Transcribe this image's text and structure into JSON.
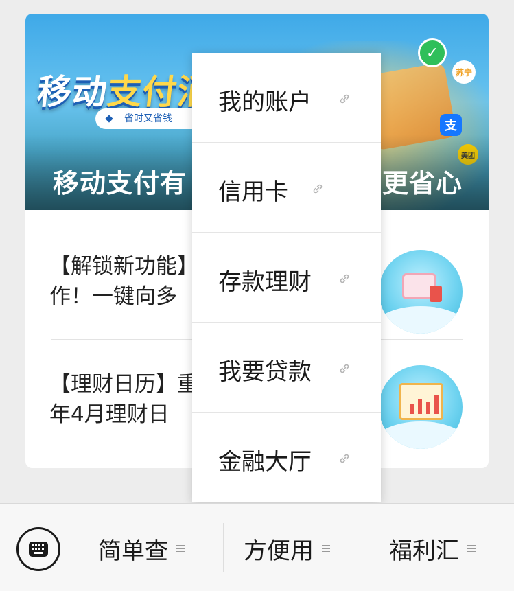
{
  "banner": {
    "logo_part1": "移动",
    "logo_part2": "支付消",
    "pill_text": "省时又省钱",
    "caption_left": "移动支付有",
    "caption_right": "更省心",
    "icon_pay": "支",
    "icon_bear": "苏宁",
    "icon_meituan": "美团"
  },
  "articles": [
    {
      "line1": "【解锁新功能】",
      "line2": "作！一键向多"
    },
    {
      "line1": "【理财日历】重",
      "line2": "年4月理财日"
    }
  ],
  "dropdown": {
    "items": [
      {
        "label": "我的账户"
      },
      {
        "label": "信用卡"
      },
      {
        "label": "存款理财"
      },
      {
        "label": "我要贷款"
      },
      {
        "label": "金融大厅"
      }
    ]
  },
  "bottom_bar": {
    "tabs": [
      {
        "label": "简单查"
      },
      {
        "label": "方便用"
      },
      {
        "label": "福利汇"
      }
    ]
  }
}
